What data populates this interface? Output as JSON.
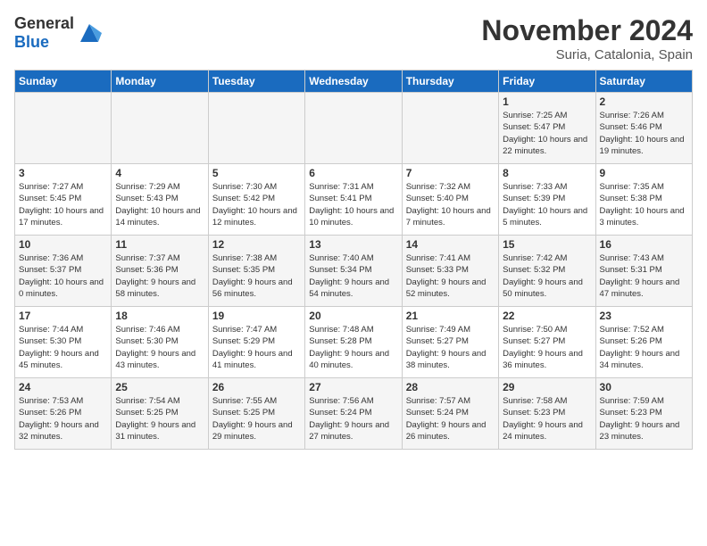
{
  "logo": {
    "general": "General",
    "blue": "Blue"
  },
  "header": {
    "month": "November 2024",
    "location": "Suria, Catalonia, Spain"
  },
  "weekdays": [
    "Sunday",
    "Monday",
    "Tuesday",
    "Wednesday",
    "Thursday",
    "Friday",
    "Saturday"
  ],
  "weeks": [
    [
      {
        "day": "",
        "info": ""
      },
      {
        "day": "",
        "info": ""
      },
      {
        "day": "",
        "info": ""
      },
      {
        "day": "",
        "info": ""
      },
      {
        "day": "",
        "info": ""
      },
      {
        "day": "1",
        "info": "Sunrise: 7:25 AM\nSunset: 5:47 PM\nDaylight: 10 hours and 22 minutes."
      },
      {
        "day": "2",
        "info": "Sunrise: 7:26 AM\nSunset: 5:46 PM\nDaylight: 10 hours and 19 minutes."
      }
    ],
    [
      {
        "day": "3",
        "info": "Sunrise: 7:27 AM\nSunset: 5:45 PM\nDaylight: 10 hours and 17 minutes."
      },
      {
        "day": "4",
        "info": "Sunrise: 7:29 AM\nSunset: 5:43 PM\nDaylight: 10 hours and 14 minutes."
      },
      {
        "day": "5",
        "info": "Sunrise: 7:30 AM\nSunset: 5:42 PM\nDaylight: 10 hours and 12 minutes."
      },
      {
        "day": "6",
        "info": "Sunrise: 7:31 AM\nSunset: 5:41 PM\nDaylight: 10 hours and 10 minutes."
      },
      {
        "day": "7",
        "info": "Sunrise: 7:32 AM\nSunset: 5:40 PM\nDaylight: 10 hours and 7 minutes."
      },
      {
        "day": "8",
        "info": "Sunrise: 7:33 AM\nSunset: 5:39 PM\nDaylight: 10 hours and 5 minutes."
      },
      {
        "day": "9",
        "info": "Sunrise: 7:35 AM\nSunset: 5:38 PM\nDaylight: 10 hours and 3 minutes."
      }
    ],
    [
      {
        "day": "10",
        "info": "Sunrise: 7:36 AM\nSunset: 5:37 PM\nDaylight: 10 hours and 0 minutes."
      },
      {
        "day": "11",
        "info": "Sunrise: 7:37 AM\nSunset: 5:36 PM\nDaylight: 9 hours and 58 minutes."
      },
      {
        "day": "12",
        "info": "Sunrise: 7:38 AM\nSunset: 5:35 PM\nDaylight: 9 hours and 56 minutes."
      },
      {
        "day": "13",
        "info": "Sunrise: 7:40 AM\nSunset: 5:34 PM\nDaylight: 9 hours and 54 minutes."
      },
      {
        "day": "14",
        "info": "Sunrise: 7:41 AM\nSunset: 5:33 PM\nDaylight: 9 hours and 52 minutes."
      },
      {
        "day": "15",
        "info": "Sunrise: 7:42 AM\nSunset: 5:32 PM\nDaylight: 9 hours and 50 minutes."
      },
      {
        "day": "16",
        "info": "Sunrise: 7:43 AM\nSunset: 5:31 PM\nDaylight: 9 hours and 47 minutes."
      }
    ],
    [
      {
        "day": "17",
        "info": "Sunrise: 7:44 AM\nSunset: 5:30 PM\nDaylight: 9 hours and 45 minutes."
      },
      {
        "day": "18",
        "info": "Sunrise: 7:46 AM\nSunset: 5:30 PM\nDaylight: 9 hours and 43 minutes."
      },
      {
        "day": "19",
        "info": "Sunrise: 7:47 AM\nSunset: 5:29 PM\nDaylight: 9 hours and 41 minutes."
      },
      {
        "day": "20",
        "info": "Sunrise: 7:48 AM\nSunset: 5:28 PM\nDaylight: 9 hours and 40 minutes."
      },
      {
        "day": "21",
        "info": "Sunrise: 7:49 AM\nSunset: 5:27 PM\nDaylight: 9 hours and 38 minutes."
      },
      {
        "day": "22",
        "info": "Sunrise: 7:50 AM\nSunset: 5:27 PM\nDaylight: 9 hours and 36 minutes."
      },
      {
        "day": "23",
        "info": "Sunrise: 7:52 AM\nSunset: 5:26 PM\nDaylight: 9 hours and 34 minutes."
      }
    ],
    [
      {
        "day": "24",
        "info": "Sunrise: 7:53 AM\nSunset: 5:26 PM\nDaylight: 9 hours and 32 minutes."
      },
      {
        "day": "25",
        "info": "Sunrise: 7:54 AM\nSunset: 5:25 PM\nDaylight: 9 hours and 31 minutes."
      },
      {
        "day": "26",
        "info": "Sunrise: 7:55 AM\nSunset: 5:25 PM\nDaylight: 9 hours and 29 minutes."
      },
      {
        "day": "27",
        "info": "Sunrise: 7:56 AM\nSunset: 5:24 PM\nDaylight: 9 hours and 27 minutes."
      },
      {
        "day": "28",
        "info": "Sunrise: 7:57 AM\nSunset: 5:24 PM\nDaylight: 9 hours and 26 minutes."
      },
      {
        "day": "29",
        "info": "Sunrise: 7:58 AM\nSunset: 5:23 PM\nDaylight: 9 hours and 24 minutes."
      },
      {
        "day": "30",
        "info": "Sunrise: 7:59 AM\nSunset: 5:23 PM\nDaylight: 9 hours and 23 minutes."
      }
    ]
  ]
}
